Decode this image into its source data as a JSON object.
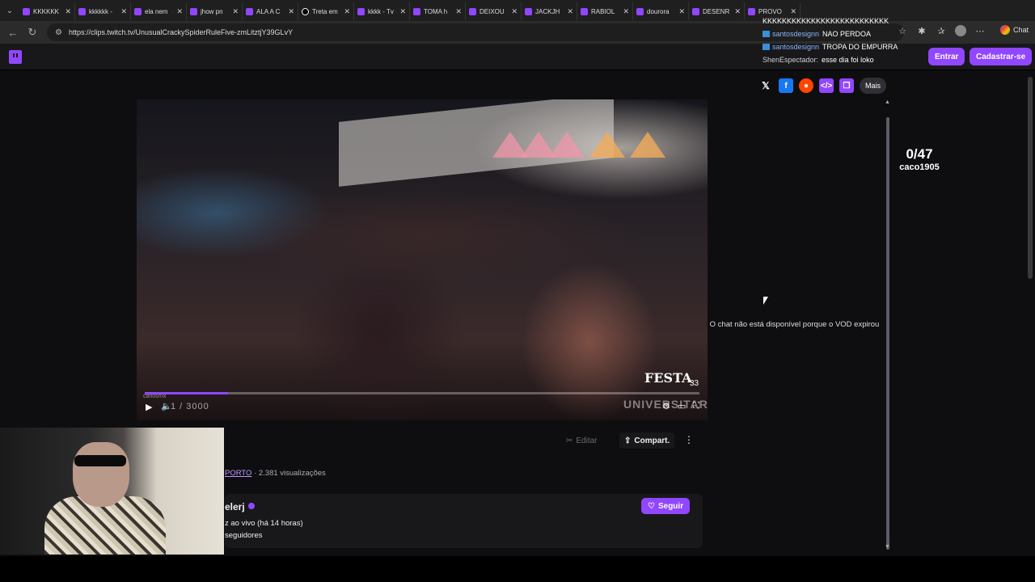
{
  "browser": {
    "tabs": [
      {
        "label": "KKKKKK",
        "icon": "twitch"
      },
      {
        "label": "kkkkkk -",
        "icon": "twitch"
      },
      {
        "label": "ela nem",
        "icon": "twitch"
      },
      {
        "label": "jhow pn",
        "icon": "twitch"
      },
      {
        "label": "ALA A C",
        "icon": "twitch"
      },
      {
        "label": "Treta em",
        "icon": "tiktok"
      },
      {
        "label": "kkkk - Tv",
        "icon": "twitch"
      },
      {
        "label": "TOMA h",
        "icon": "twitch"
      },
      {
        "label": "DEIXOU",
        "icon": "twitch"
      },
      {
        "label": "JACKJH",
        "icon": "twitch"
      },
      {
        "label": "RABIOL",
        "icon": "twitch"
      },
      {
        "label": "dourora",
        "icon": "twitch"
      },
      {
        "label": "DESENR",
        "icon": "twitch"
      },
      {
        "label": "PROVO",
        "icon": "twitch"
      }
    ],
    "url": "https://clips.twitch.tv/UnusualCrackySpiderRuleFive-zmLitztjY39GLvY",
    "chat_label": "Chat"
  },
  "stream_chat_overlay": [
    {
      "user": "",
      "message": "KKKKKKKKKKKKKKKKKKKKKKKKKK"
    },
    {
      "user": "santosdesignn",
      "message": "NAO PERDOA"
    },
    {
      "user": "santosdesignn",
      "message": "TROPA DO EMPURRA"
    },
    {
      "user": "ShenEspectador:",
      "message": "esse dia foi loko"
    }
  ],
  "twitch_nav": {
    "login": "Entrar",
    "signup": "Cadastrar-se"
  },
  "share_bar": {
    "more": "Mais"
  },
  "video": {
    "clip_author": "carlosrnx",
    "timer": "1 / 3000",
    "watermark_top": "FESTA",
    "watermark_num": "33",
    "watermark_bottom": "UNIVERSITARIA",
    "progress": 0.15
  },
  "clip_actions": {
    "edit": "Editar",
    "share": "Compart."
  },
  "clip_info": {
    "category": "PORTO",
    "views": " · 2.381 visualizações"
  },
  "channel": {
    "name": "elerj",
    "live_status": "z ao vivo (há 14 horas)",
    "followers": "seguidores",
    "follow": "Seguir"
  },
  "chat_panel": {
    "unavailable": "O chat não está disponível porque o VOD expirou"
  },
  "overlay_counter": {
    "count": "0/47",
    "name": "caco1905"
  }
}
